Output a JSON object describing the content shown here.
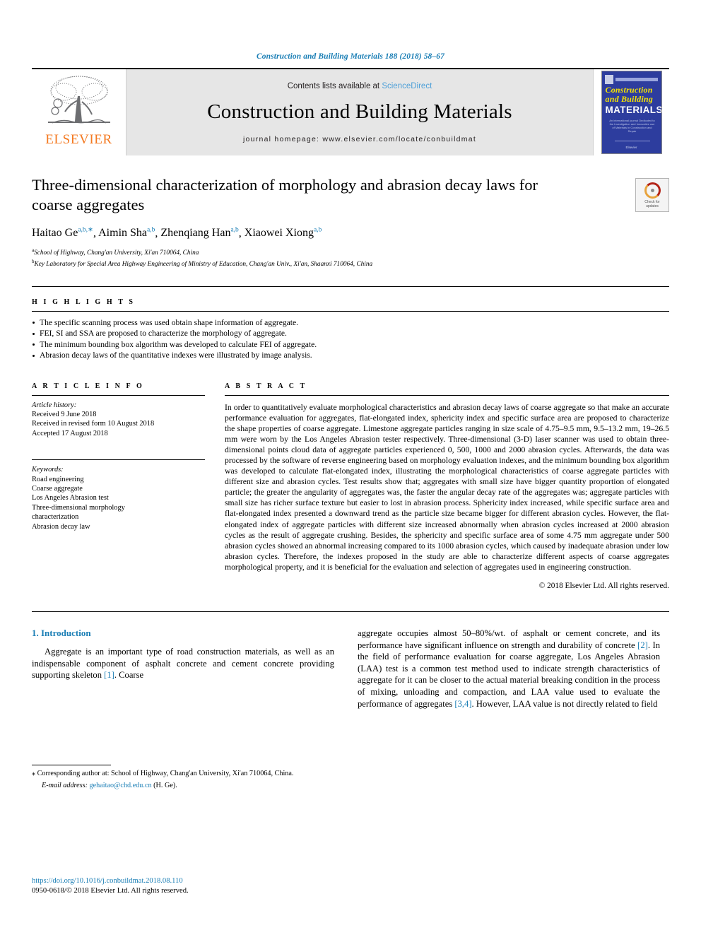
{
  "running_head": "Construction and Building Materials 188 (2018) 58–67",
  "masthead": {
    "publisher_name": "ELSEVIER",
    "contents_prefix": "Contents lists available at",
    "sciencedirect": "ScienceDirect",
    "journal_title": "Construction and Building Materials",
    "homepage": "journal homepage: www.elsevier.com/locate/conbuildmat",
    "cover": {
      "line1": "Construction",
      "line2": "and Building",
      "line3": "MATERIALS",
      "blurb": "An international journal Dedicated to the Investigation and Innovative use of Materials in Construction and Repair",
      "footer": "Elsevier"
    }
  },
  "article": {
    "title": "Three-dimensional characterization of morphology and abrasion decay laws for coarse aggregates",
    "authors": [
      {
        "name": "Haitao Ge",
        "sup": "a,b,∗"
      },
      {
        "name": "Aimin Sha",
        "sup": "a,b"
      },
      {
        "name": "Zhenqiang Han",
        "sup": "a,b"
      },
      {
        "name": "Xiaowei Xiong",
        "sup": "a,b"
      }
    ],
    "affiliations": [
      {
        "marker": "a",
        "text": "School of Highway, Chang'an University, Xi'an 710064, China"
      },
      {
        "marker": "b",
        "text": "Key Laboratory for Special Area Highway Engineering of Ministry of Education, Chang'an Univ., Xi'an, Shaanxi 710064, China"
      }
    ],
    "crossmark": {
      "line1": "Check for",
      "line2": "updates"
    }
  },
  "highlights": {
    "label": "H I G H L I G H T S",
    "items": [
      "The specific scanning process was used obtain shape information of aggregate.",
      "FEI, SI and SSA are proposed to characterize the morphology of aggregate.",
      "The minimum bounding box algorithm was developed to calculate FEI of aggregate.",
      "Abrasion decay laws of the quantitative indexes were illustrated by image analysis."
    ]
  },
  "article_info": {
    "label": "A R T I C L E   I N F O",
    "history_head": "Article history:",
    "history": [
      "Received 9 June 2018",
      "Received in revised form 10 August 2018",
      "Accepted 17 August 2018"
    ],
    "keywords_head": "Keywords:",
    "keywords": [
      "Road engineering",
      "Coarse aggregate",
      "Los Angeles Abrasion test",
      "Three-dimensional morphology",
      "characterization",
      "Abrasion decay law"
    ]
  },
  "abstract": {
    "label": "A B S T R A C T",
    "text": "In order to quantitatively evaluate morphological characteristics and abrasion decay laws of coarse aggregate so that make an accurate performance evaluation for aggregates, flat-elongated index, sphericity index and specific surface area are proposed to characterize the shape properties of coarse aggregate. Limestone aggregate particles ranging in size scale of 4.75–9.5 mm, 9.5–13.2 mm, 19–26.5 mm were worn by the Los Angeles Abrasion tester respectively. Three-dimensional (3-D) laser scanner was used to obtain three-dimensional points cloud data of aggregate particles experienced 0, 500, 1000 and 2000 abrasion cycles. Afterwards, the data was processed by the software of reverse engineering based on morphology evaluation indexes, and the minimum bounding box algorithm was developed to calculate flat-elongated index, illustrating the morphological characteristics of coarse aggregate particles with different size and abrasion cycles. Test results show that; aggregates with small size have bigger quantity proportion of elongated particle; the greater the angularity of aggregates was, the faster the angular decay rate of the aggregates was; aggregate particles with small size has richer surface texture but easier to lost in abrasion process. Sphericity index increased, while specific surface area and flat-elongated index presented a downward trend as the particle size became bigger for different abrasion cycles. However, the flat-elongated index of aggregate particles with different size increased abnormally when abrasion cycles increased at 2000 abrasion cycles as the result of aggregate crushing. Besides, the sphericity and specific surface area of some 4.75 mm aggregate under 500 abrasion cycles showed an abnormal increasing compared to its 1000 abrasion cycles, which caused by inadequate abrasion under low abrasion cycles. Therefore, the indexes proposed in the study are able to characterize different aspects of coarse aggregates morphological property, and it is beneficial for the evaluation and selection of aggregates used in engineering construction.",
    "copyright": "© 2018 Elsevier Ltd. All rights reserved."
  },
  "body": {
    "section_number_title": "1. Introduction",
    "left_paragraph_pre": "Aggregate is an important type of road construction materials, as well as an indispensable component of asphalt concrete and cement concrete providing supporting skeleton ",
    "left_ref": "[1]",
    "left_paragraph_post": ". Coarse",
    "right_paragraph_1": "aggregate occupies almost 50–80%/wt. of asphalt or cement concrete, and its performance have significant influence on strength and durability of concrete ",
    "right_ref_1": "[2]",
    "right_paragraph_2": ". In the field of performance evaluation for coarse aggregate, Los Angeles Abrasion (LAA) test is a common test method used to indicate strength characteristics of aggregate for it can be closer to the actual material breaking condition in the process of mixing, unloading and compaction, and LAA value used to evaluate the performance of aggregates ",
    "right_ref_2": "[3,4]",
    "right_paragraph_3": ". However, LAA value is not directly related to field"
  },
  "footnote": {
    "corresponding": "⁎ Corresponding author at: School of Highway, Chang'an University, Xi'an 710064, China.",
    "email_label": "E-mail address:",
    "email": "gehaitao@chd.edu.cn",
    "email_suffix": " (H. Ge)."
  },
  "footer": {
    "doi": "https://doi.org/10.1016/j.conbuildmat.2018.08.110",
    "issn": "0950-0618/© 2018 Elsevier Ltd. All rights reserved."
  },
  "colors": {
    "link": "#1a7eb5",
    "elsevier_orange": "#f47920",
    "sciencedirect": "#4ea0d8",
    "masthead_bg": "#e6e6e6",
    "cover_blue": "#2d3d9e"
  }
}
